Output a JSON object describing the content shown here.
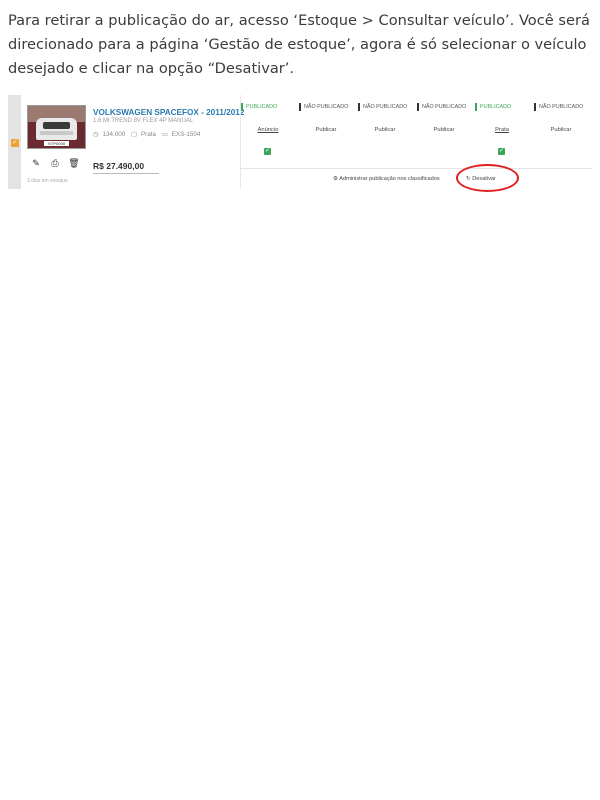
{
  "instruction": "Para retirar a publicação do ar, acesso ‘Estoque > Consultar veículo’. Você será direcionado para a página ‘Gestão de estoque’, agora é só selecionar o veículo desejado e clicar na opção “Desativar’.",
  "vehicle": {
    "title": "VOLKSWAGEN SPACEFOX - 2011/2012",
    "subtitle": "1.6 MI TREND 8V FLEX 4P MANUAL",
    "mileage": "134.000",
    "color": "Prata",
    "plate": "EXS-1504",
    "price": "R$ 27.490,00",
    "days_in_stock": "3 dias em estoque",
    "photo_plate_text": "NTP5008"
  },
  "tool_icons": [
    "pencil-icon",
    "printer-icon",
    "trash-icon"
  ],
  "columns": [
    {
      "status": "PUBLICADO",
      "action": "Anúncio",
      "checked": true
    },
    {
      "status": "NÃO PUBLICADO",
      "action": "Publicar",
      "checked": false
    },
    {
      "status": "NÃO PUBLICADO",
      "action": "Publicar",
      "checked": false
    },
    {
      "status": "NÃO PUBLICADO",
      "action": "Publicar",
      "checked": false
    },
    {
      "status": "PUBLICADO",
      "action": "Prata",
      "checked": true
    },
    {
      "status": "NÃO PUBLICADO",
      "action": "Publicar",
      "checked": false
    }
  ],
  "footer": {
    "admin_label": "Administrar publicação nos classificados",
    "deactivate_label": "Desativar"
  },
  "colors": {
    "published": "#3aa757",
    "link": "#2a7ab0",
    "highlight_ring": "#e02020",
    "checkbox": "#f0a030"
  }
}
